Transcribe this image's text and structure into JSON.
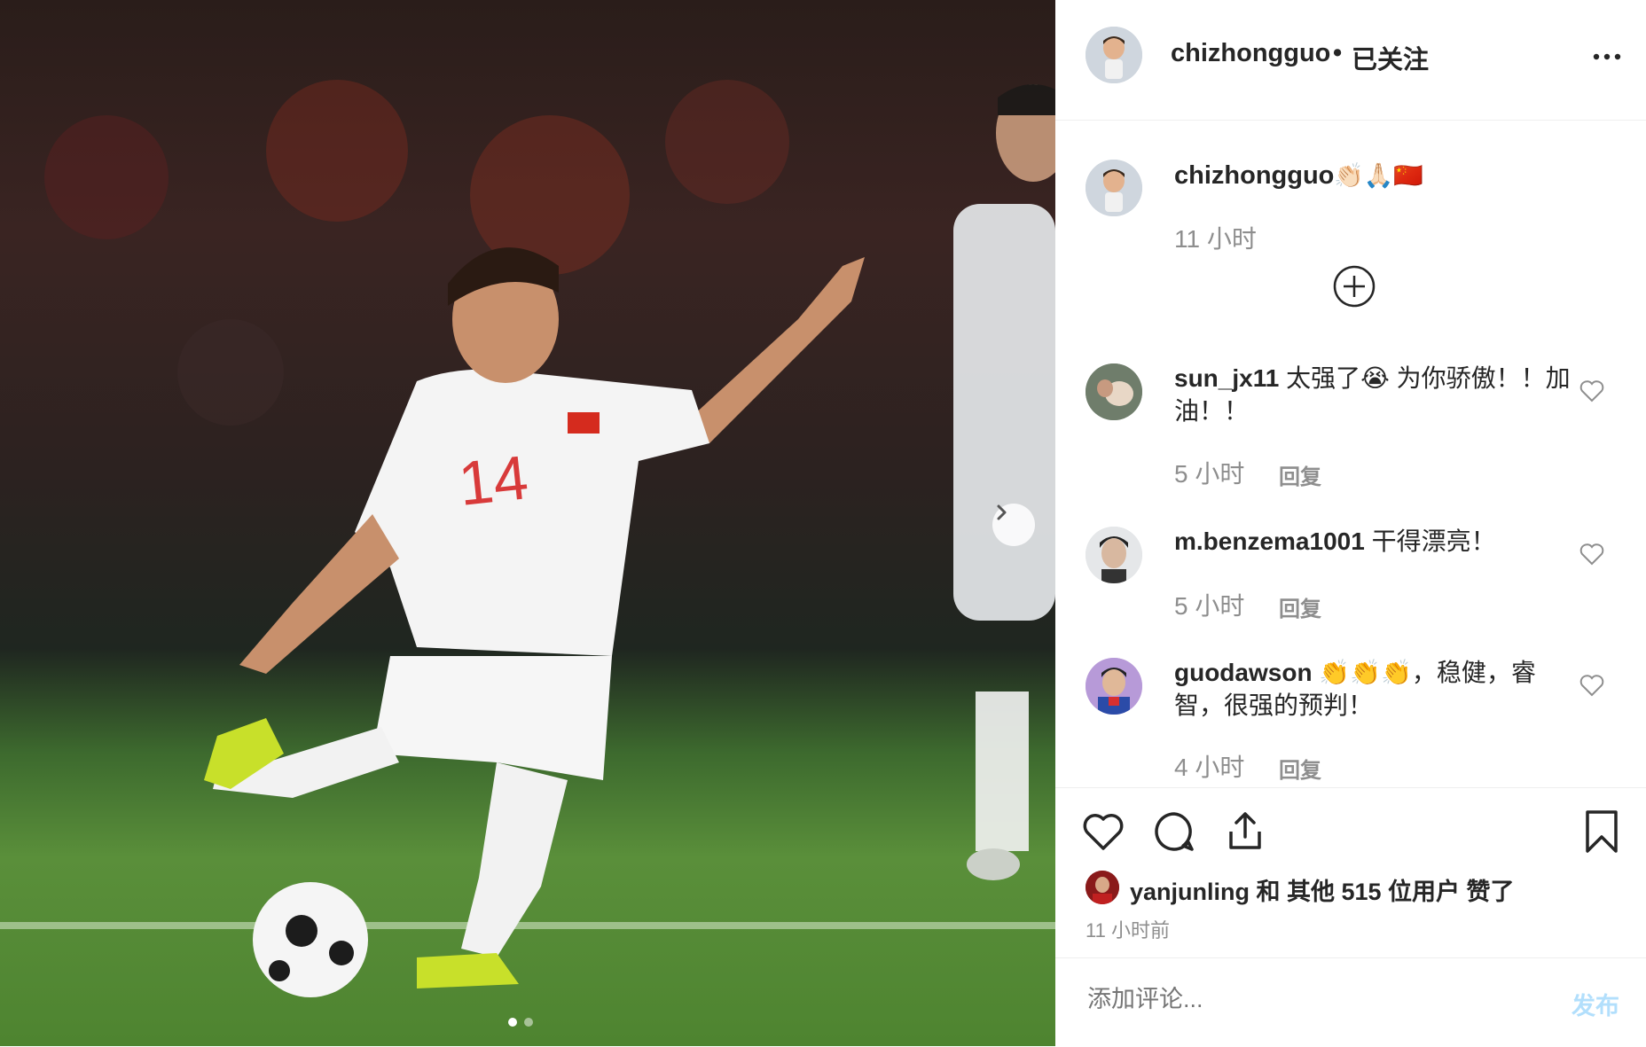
{
  "post": {
    "username": "chizhongguo",
    "separator": "•",
    "follow_status": "已关注",
    "caption_emojis": "👏🏻🙏🏻🇨🇳",
    "caption_time": "11 小时"
  },
  "comments": [
    {
      "user": "sun_jx11",
      "text": " 太强了😭 为你骄傲！！加油！！",
      "time": "5 小时",
      "reply": "回复"
    },
    {
      "user": "m.benzema1001",
      "text": " 干得漂亮！",
      "time": "5 小时",
      "reply": "回复"
    },
    {
      "user": "guodawson",
      "text": " 👏👏👏，稳健，睿智，很强的预判！",
      "time": "4 小时",
      "reply": "回复"
    }
  ],
  "likes": {
    "first_user": "yanjunling",
    "rest": " 和 其他 515 位用户 赞了"
  },
  "timestamp": "11 小时前",
  "comment_input": {
    "placeholder": "添加评论...",
    "post_label": "发布"
  },
  "carousel": {
    "current": 1,
    "total": 2
  },
  "colors": {
    "post_disabled": "#b2dffc",
    "secondary_text": "#8e8e8e",
    "primary_text": "#262626"
  }
}
